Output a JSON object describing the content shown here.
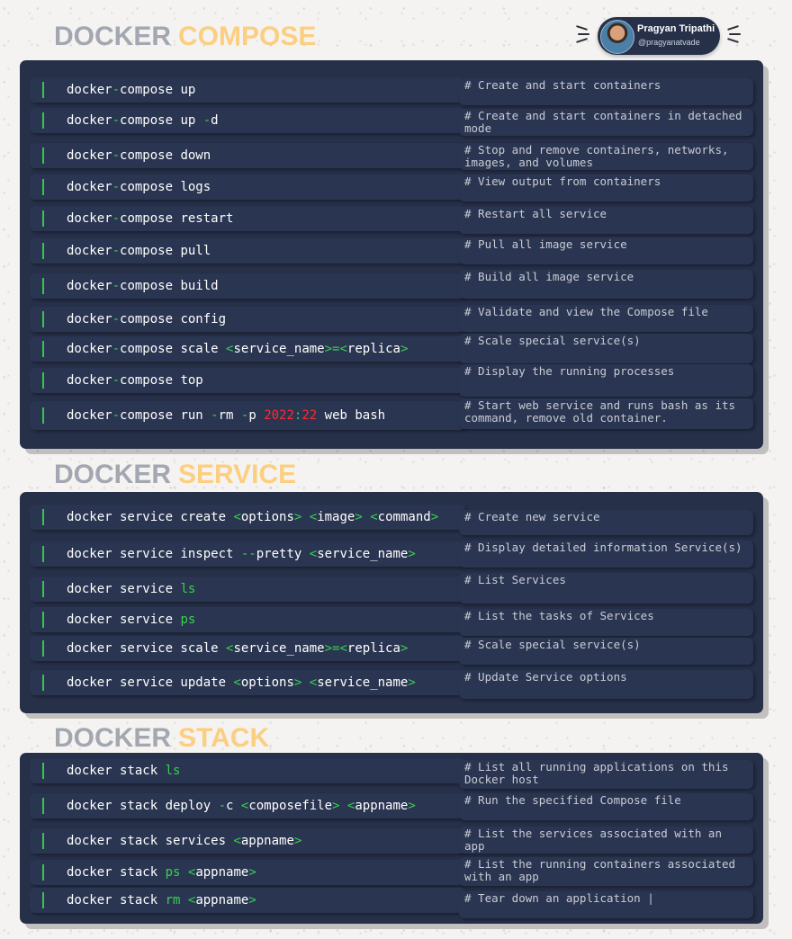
{
  "author": {
    "name": "Pragyan Tripathi",
    "handle": "@pragyanatvade"
  },
  "sections": [
    {
      "title_a": "DOCKER",
      "title_b": "COMPOSE",
      "rows": [
        {
          "cmd": [
            {
              "t": "docker"
            },
            {
              "t": "-",
              "g": 1
            },
            {
              "t": "compose up"
            }
          ],
          "comment": "# Create and start containers"
        },
        {
          "cmd": [
            {
              "t": "docker"
            },
            {
              "t": "-",
              "g": 1
            },
            {
              "t": "compose up "
            },
            {
              "t": "-",
              "g": 1
            },
            {
              "t": "d"
            }
          ],
          "comment": "# Create and start containers in detached mode"
        },
        {
          "cmd": [
            {
              "t": "docker"
            },
            {
              "t": "-",
              "g": 1
            },
            {
              "t": "compose down"
            }
          ],
          "comment": "# Stop and remove containers, networks, images, and volumes"
        },
        {
          "cmd": [
            {
              "t": "docker"
            },
            {
              "t": "-",
              "g": 1
            },
            {
              "t": "compose logs"
            }
          ],
          "comment": "# View output from containers"
        },
        {
          "cmd": [
            {
              "t": "docker"
            },
            {
              "t": "-",
              "g": 1
            },
            {
              "t": "compose restart"
            }
          ],
          "comment": "# Restart all service"
        },
        {
          "cmd": [
            {
              "t": "docker"
            },
            {
              "t": "-",
              "g": 1
            },
            {
              "t": "compose pull"
            }
          ],
          "comment": "# Pull all image service"
        },
        {
          "cmd": [
            {
              "t": "docker"
            },
            {
              "t": "-",
              "g": 1
            },
            {
              "t": "compose build"
            }
          ],
          "comment": "# Build all image service"
        },
        {
          "cmd": [
            {
              "t": "docker"
            },
            {
              "t": "-",
              "g": 1
            },
            {
              "t": "compose config"
            }
          ],
          "comment": "# Validate and view the Compose file"
        },
        {
          "cmd": [
            {
              "t": "docker"
            },
            {
              "t": "-",
              "g": 1
            },
            {
              "t": "compose scale "
            },
            {
              "t": "<",
              "g": 1
            },
            {
              "t": "service_name"
            },
            {
              "t": ">=<",
              "g": 1
            },
            {
              "t": "replica"
            },
            {
              "t": ">",
              "g": 1
            }
          ],
          "comment": "# Scale special service(s)"
        },
        {
          "cmd": [
            {
              "t": "docker"
            },
            {
              "t": "-",
              "g": 1
            },
            {
              "t": "compose top"
            }
          ],
          "comment": "# Display the running processes"
        },
        {
          "cmd": [
            {
              "t": "docker"
            },
            {
              "t": "-",
              "g": 1
            },
            {
              "t": "compose run "
            },
            {
              "t": "-",
              "g": 1
            },
            {
              "t": "rm "
            },
            {
              "t": "-",
              "g": 1
            },
            {
              "t": "p "
            },
            {
              "t": "2022",
              "r": 1
            },
            {
              "t": ":",
              "g": 1
            },
            {
              "t": "22",
              "r": 1
            },
            {
              "t": " web bash"
            }
          ],
          "comment": "# Start web service and runs bash as its command, remove old container."
        }
      ]
    },
    {
      "title_a": "DOCKER",
      "title_b": "SERVICE",
      "rows": [
        {
          "cmd": [
            {
              "t": "docker service create "
            },
            {
              "t": "<",
              "g": 1
            },
            {
              "t": "options"
            },
            {
              "t": ">",
              "g": 1
            },
            {
              "t": " "
            },
            {
              "t": "<",
              "g": 1
            },
            {
              "t": "image"
            },
            {
              "t": ">",
              "g": 1
            },
            {
              "t": " "
            },
            {
              "t": "<",
              "g": 1
            },
            {
              "t": "command"
            },
            {
              "t": ">",
              "g": 1
            }
          ],
          "comment": "# Create new service"
        },
        {
          "cmd": [
            {
              "t": "docker service inspect "
            },
            {
              "t": "--",
              "g": 1
            },
            {
              "t": "pretty "
            },
            {
              "t": "<",
              "g": 1
            },
            {
              "t": "service_name"
            },
            {
              "t": ">",
              "g": 1
            }
          ],
          "comment": "# Display detailed information Service(s)"
        },
        {
          "cmd": [
            {
              "t": "docker service "
            },
            {
              "t": "ls",
              "g": 1
            }
          ],
          "comment": "# List Services"
        },
        {
          "cmd": [
            {
              "t": "docker service "
            },
            {
              "t": "ps",
              "g": 1
            }
          ],
          "comment": "# List the tasks of Services"
        },
        {
          "cmd": [
            {
              "t": "docker service scale "
            },
            {
              "t": "<",
              "g": 1
            },
            {
              "t": "service_name"
            },
            {
              "t": ">=<",
              "g": 1
            },
            {
              "t": "replica"
            },
            {
              "t": ">",
              "g": 1
            }
          ],
          "comment": "# Scale special service(s)"
        },
        {
          "cmd": [
            {
              "t": "docker service update "
            },
            {
              "t": "<",
              "g": 1
            },
            {
              "t": "options"
            },
            {
              "t": ">",
              "g": 1
            },
            {
              "t": " "
            },
            {
              "t": "<",
              "g": 1
            },
            {
              "t": "service_name"
            },
            {
              "t": ">",
              "g": 1
            }
          ],
          "comment": "# Update Service options"
        }
      ]
    },
    {
      "title_a": "DOCKER",
      "title_b": "STACK",
      "rows": [
        {
          "cmd": [
            {
              "t": "docker stack "
            },
            {
              "t": "ls",
              "g": 1
            }
          ],
          "comment": "# List all running applications on this Docker host"
        },
        {
          "cmd": [
            {
              "t": "docker stack deploy "
            },
            {
              "t": "-",
              "g": 1
            },
            {
              "t": "c "
            },
            {
              "t": "<",
              "g": 1
            },
            {
              "t": "composefile"
            },
            {
              "t": ">",
              "g": 1
            },
            {
              "t": " "
            },
            {
              "t": "<",
              "g": 1
            },
            {
              "t": "appname"
            },
            {
              "t": ">",
              "g": 1
            }
          ],
          "comment": "# Run the specified Compose file"
        },
        {
          "cmd": [
            {
              "t": "docker stack services "
            },
            {
              "t": "<",
              "g": 1
            },
            {
              "t": "appname"
            },
            {
              "t": ">",
              "g": 1
            }
          ],
          "comment": "# List the services associated with an app"
        },
        {
          "cmd": [
            {
              "t": "docker stack "
            },
            {
              "t": "ps",
              "g": 1
            },
            {
              "t": " "
            },
            {
              "t": "<",
              "g": 1
            },
            {
              "t": "appname"
            },
            {
              "t": ">",
              "g": 1
            }
          ],
          "comment": "# List the running containers associated with an app"
        },
        {
          "cmd": [
            {
              "t": "docker stack "
            },
            {
              "t": "rm",
              "g": 1
            },
            {
              "t": " "
            },
            {
              "t": "<",
              "g": 1
            },
            {
              "t": "appname"
            },
            {
              "t": ">",
              "g": 1
            }
          ],
          "comment": "# Tear down an application |"
        }
      ]
    }
  ],
  "colors": {
    "panel": "#263049",
    "accent_green": "#37d04f",
    "title_gray": "#a3a7b1",
    "title_orange": "#fccf80",
    "number_red": "#ff2a37"
  }
}
